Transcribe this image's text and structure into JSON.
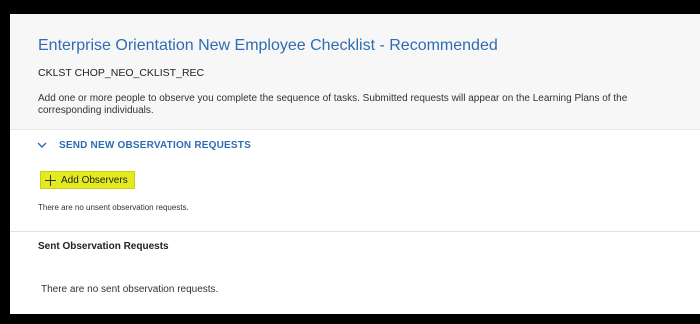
{
  "checklist": {
    "title": "Enterprise Orientation New Employee Checklist - Recommended",
    "code": "CKLST CHOP_NEO_CKLIST_REC",
    "description": "Add one or more people to observe you complete the sequence of tasks. Submitted requests will appear on the Learning Plans of the corresponding individuals."
  },
  "new_requests": {
    "section_label": "SEND NEW OBSERVATION REQUESTS",
    "toggle_icon": "chevron-down-icon",
    "add_button_label": "Add Observers",
    "add_button_color": "#e3ea1e",
    "empty_message": "There are no unsent observation requests."
  },
  "sent_requests": {
    "title": "Sent Observation Requests",
    "empty_message": "There are no sent observation requests."
  },
  "colors": {
    "accent": "#2e6db4",
    "highlight": "#e3ea1e"
  }
}
